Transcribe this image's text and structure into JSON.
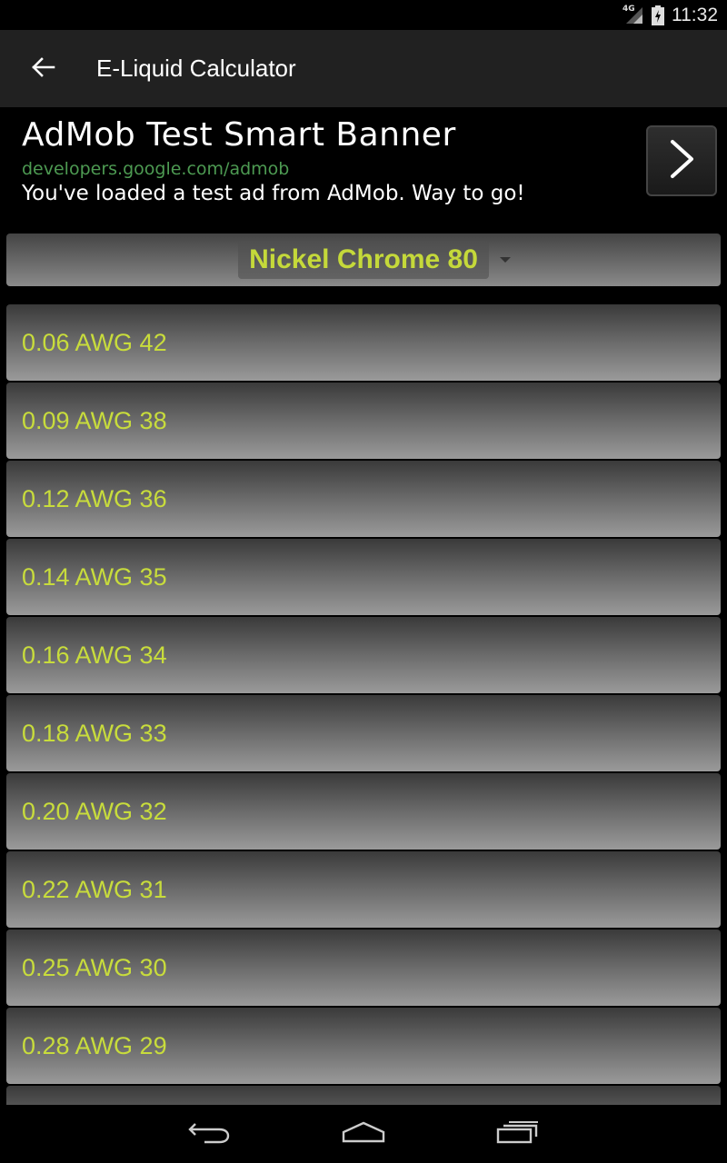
{
  "status_bar": {
    "network_label": "4G",
    "time": "11:32"
  },
  "action_bar": {
    "title": "E-Liquid Calculator"
  },
  "ad": {
    "title": "AdMob Test Smart Banner",
    "url": "developers.google.com/admob",
    "description": "You've loaded a test ad from AdMob. Way to go!"
  },
  "spinner": {
    "selected": "Nickel Chrome 80"
  },
  "list": {
    "items": [
      {
        "label": "0.06 AWG 42"
      },
      {
        "label": "0.09 AWG 38"
      },
      {
        "label": "0.12 AWG 36"
      },
      {
        "label": "0.14 AWG 35"
      },
      {
        "label": "0.16 AWG 34"
      },
      {
        "label": "0.18 AWG 33"
      },
      {
        "label": "0.20 AWG 32"
      },
      {
        "label": "0.22 AWG 31"
      },
      {
        "label": "0.25 AWG 30"
      },
      {
        "label": "0.28 AWG 29"
      },
      {
        "label": ""
      }
    ]
  },
  "colors": {
    "accent_text": "#c8dc3c",
    "ad_url": "#4d9a52",
    "action_bar_bg": "#212121"
  },
  "icons": {
    "back": "arrow-left-icon",
    "ad_arrow": "chevron-right-icon",
    "nav_back": "back-icon",
    "nav_home": "home-icon",
    "nav_recents": "recents-icon"
  }
}
